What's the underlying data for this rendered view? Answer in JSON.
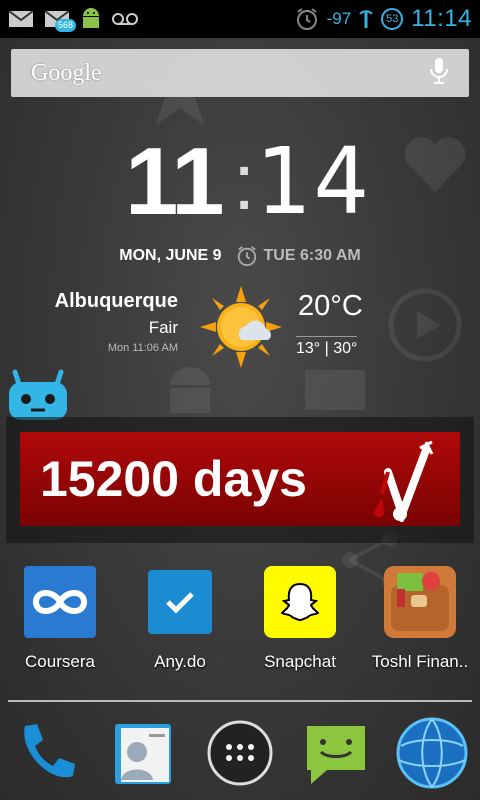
{
  "status_bar": {
    "notifications": [
      "gmail-icon",
      "gmail-icon",
      "android-icon",
      "voicemail-icon"
    ],
    "gmail_badge": "568",
    "alarm_icon": "alarm-icon",
    "signal_text": "-97",
    "circle_count": "53",
    "time": "11:14",
    "accent_color": "#33b5e5"
  },
  "search": {
    "label": "Google",
    "mic_icon": "mic-icon"
  },
  "clock": {
    "hours": "11",
    "minutes": "14",
    "date": "MON, JUNE 9",
    "alarm": "TUE 6:30 AM"
  },
  "weather": {
    "city": "Albuquerque",
    "condition": "Fair",
    "updated": "Mon 11:06 AM",
    "temp": "20°C",
    "range": "13° | 30°",
    "icon": "sun-cloud-icon"
  },
  "days_widget": {
    "text": "15200 days",
    "bg_color": "#a00606"
  },
  "apps": [
    {
      "label": "Coursera",
      "icon": "coursera-icon"
    },
    {
      "label": "Any.do",
      "icon": "anydo-icon"
    },
    {
      "label": "Snapchat",
      "icon": "snapchat-icon"
    },
    {
      "label": "Toshl Finan..",
      "icon": "toshl-icon"
    }
  ],
  "dock": [
    "phone-icon",
    "contacts-icon",
    "app-drawer-icon",
    "messaging-icon",
    "browser-globe-icon"
  ]
}
